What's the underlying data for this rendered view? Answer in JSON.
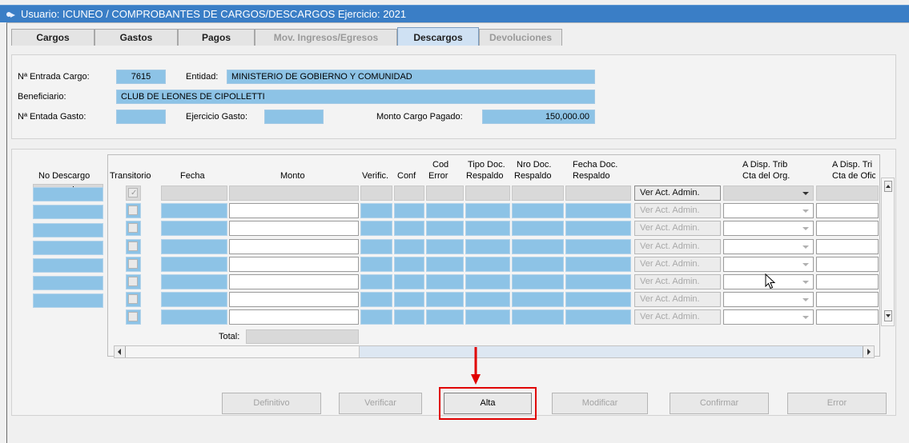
{
  "window": {
    "title": "Usuario: ICUNEO  /  COMPROBANTES DE CARGOS/DESCARGOS  Ejercicio: 2021"
  },
  "tabs": [
    {
      "label": "Cargos",
      "state": "normal"
    },
    {
      "label": "Gastos",
      "state": "normal"
    },
    {
      "label": "Pagos",
      "state": "normal"
    },
    {
      "label": "Mov. Ingresos/Egresos",
      "state": "disabled"
    },
    {
      "label": "Descargos",
      "state": "active"
    },
    {
      "label": "Devoluciones",
      "state": "disabled"
    }
  ],
  "header_form": {
    "entrada_cargo_label": "Nª Entrada Cargo:",
    "entrada_cargo_value": "7615",
    "entidad_label": "Entidad:",
    "entidad_value": "MINISTERIO DE GOBIERNO Y COMUNIDAD",
    "beneficiario_label": "Beneficiario:",
    "beneficiario_value": "CLUB DE LEONES DE CIPOLLETTI",
    "entada_gasto_label": "Nª Entada Gasto:",
    "entada_gasto_value": "",
    "ejercicio_gasto_label": "Ejercicio Gasto:",
    "ejercicio_gasto_value": "",
    "monto_cargo_label": "Monto Cargo Pagado:",
    "monto_cargo_value": "150,000.00"
  },
  "descargos": {
    "no_descargo_label": "No Descargo",
    "columns": {
      "transitorio": "Transitorio",
      "fecha": "Fecha",
      "monto": "Monto",
      "verific": "Verific.",
      "conf": "Conf",
      "cod_error_1": "Cod",
      "cod_error_2": "Error",
      "tipo_doc_1": "Tipo Doc.",
      "tipo_doc_2": "Respaldo",
      "nro_doc_1": "Nro Doc.",
      "nro_doc_2": "Respaldo",
      "fecha_doc_1": "Fecha Doc.",
      "fecha_doc_2": "Respaldo",
      "disp_org_1": "A Disp. Trib",
      "disp_org_2": "Cta del Org.",
      "disp_of_1": "A Disp. Tri",
      "disp_of_2": "Cta de Ofic"
    },
    "row_button_label": "Ver Act. Admin.",
    "row_count": 8,
    "total_label": "Total:",
    "total_value": ""
  },
  "actions": {
    "definitivo": "Definitivo",
    "verificar": "Verificar",
    "alta": "Alta",
    "modificar": "Modificar",
    "confirmar": "Confirmar",
    "error": "Error"
  },
  "colors": {
    "title_bar": "#3a7ec6",
    "field_blue": "#8dc3e6",
    "highlight_red": "#e00000"
  }
}
